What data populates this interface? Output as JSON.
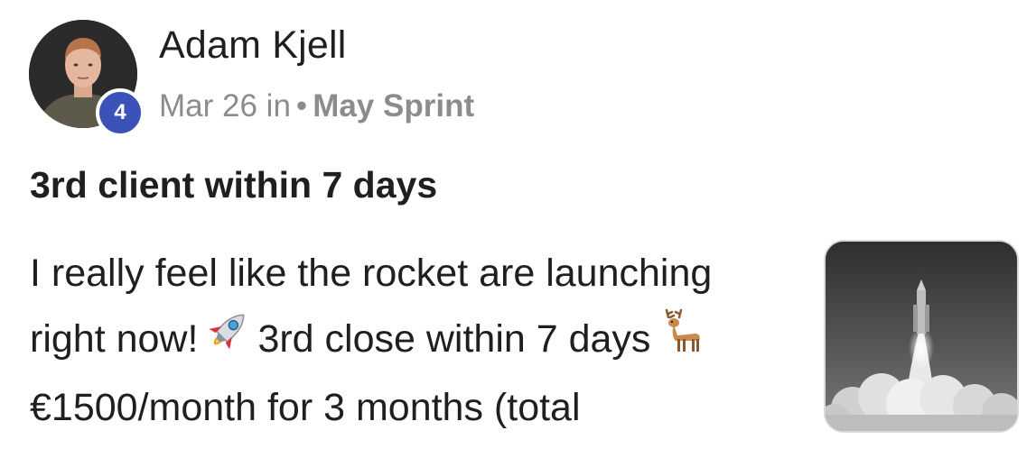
{
  "author": {
    "name": "Adam Kjell",
    "level": "4",
    "avatar_icon": "user-photo-avatar"
  },
  "meta": {
    "date": "Mar 26",
    "in_label": "in",
    "separator": "•",
    "group": "May Sprint"
  },
  "post": {
    "title": "3rd client within 7 days",
    "body_lines": [
      "I really feel like the rocket are launching",
      "right now!",
      "3rd close within 7 days",
      "€1500/month for 3 months (total"
    ],
    "emojis": [
      "rocket-emoji",
      "deer-emoji"
    ],
    "thumbnail_icon": "rocket-launch-photo"
  },
  "colors": {
    "badge": "#3b52b8",
    "meta_text": "#8c8c8c",
    "text": "#1f1f1f"
  }
}
